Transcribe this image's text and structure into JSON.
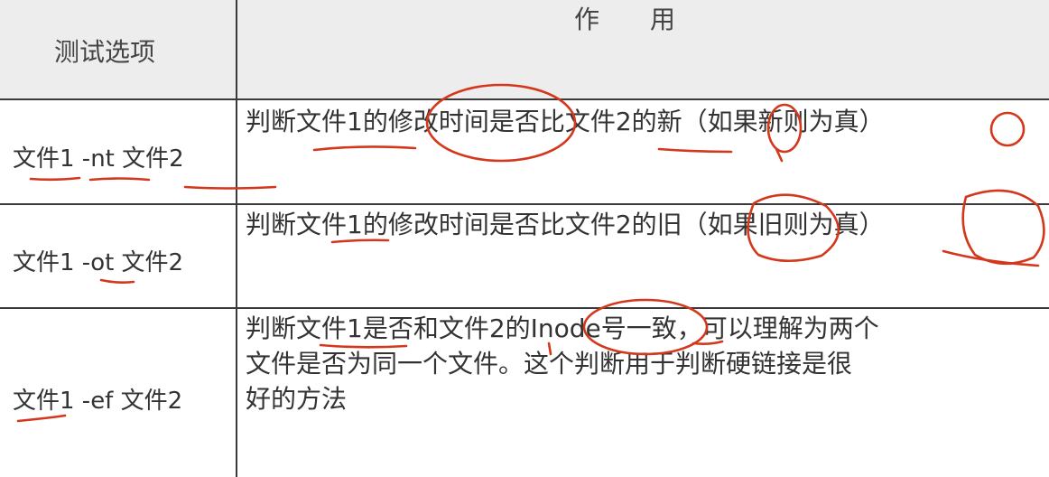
{
  "table": {
    "headers": {
      "option": "测试选项",
      "function": "作　　用"
    },
    "rows": [
      {
        "option": "文件1 -nt 文件2",
        "description_lines": [
          "判断文件1的修改时间是否比文件2的新（如果新则为真）"
        ]
      },
      {
        "option": "文件1 -ot 文件2",
        "description_lines": [
          "判断文件1的修改时间是否比文件2的旧（如果旧则为真）"
        ]
      },
      {
        "option": "文件1 -ef 文件2",
        "description_lines": [
          "判断文件1是否和文件2的Inode号一致，可以理解为两个",
          "文件是否为同一个文件。这个判断用于判断硬链接是很",
          "好的方法"
        ]
      }
    ]
  },
  "colors": {
    "border": "#3a3a3a",
    "header_bg": "#ededed",
    "annotation_ink": "#d4381c",
    "text": "#333333"
  }
}
